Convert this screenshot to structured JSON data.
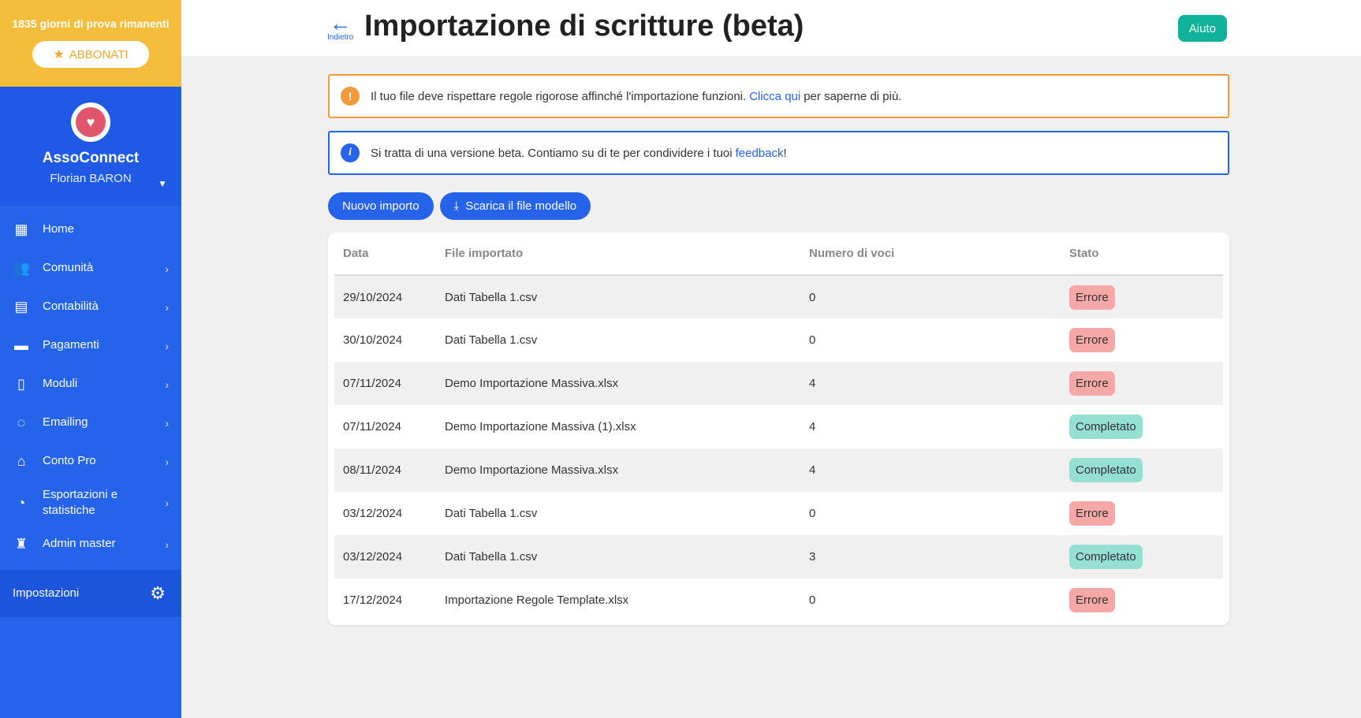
{
  "trial": {
    "text": "1835 giorni di prova rimanenti",
    "subscribe_label": "ABBONATI"
  },
  "org": {
    "name": "AssoConnect",
    "user": "Florian BARON"
  },
  "nav": [
    {
      "label": "Home",
      "icon": "dashboard-icon",
      "glyph": "▦"
    },
    {
      "label": "Comunità",
      "icon": "people-icon",
      "glyph": "👥"
    },
    {
      "label": "Contabilità",
      "icon": "calculator-icon",
      "glyph": "▤"
    },
    {
      "label": "Pagamenti",
      "icon": "credit-card-icon",
      "glyph": "▬"
    },
    {
      "label": "Moduli",
      "icon": "document-icon",
      "glyph": "▯"
    },
    {
      "label": "Emailing",
      "icon": "chat-icon",
      "glyph": "◌"
    },
    {
      "label": "Conto Pro",
      "icon": "bank-icon",
      "glyph": "⌂"
    },
    {
      "label": "Esportazioni e statistiche",
      "icon": "pie-chart-icon",
      "glyph": "◔"
    },
    {
      "label": "Admin master",
      "icon": "admin-icon",
      "glyph": "♜"
    }
  ],
  "settings_label": "Impostazioni",
  "header": {
    "back_label": "Indietro",
    "title": "Importazione di scritture (beta)",
    "help_label": "Aiuto"
  },
  "alerts": {
    "warning": {
      "before": "Il tuo file deve rispettare regole rigorose affinché l'importazione funzioni.",
      "link": "Clicca qui",
      "after": "per saperne di più."
    },
    "info": {
      "before": "Si tratta di una versione beta. Contiamo su di te per condividere i tuoi",
      "link": "feedback",
      "after": "!"
    }
  },
  "actions": {
    "new_import": "Nuovo importo",
    "download_template": "Scarica il file modello"
  },
  "table": {
    "headers": [
      "Data",
      "File importato",
      "Numero di voci",
      "Stato"
    ],
    "rows": [
      {
        "date": "29/10/2024",
        "file": "Dati Tabella 1.csv",
        "count": "0",
        "status": "Errore"
      },
      {
        "date": "30/10/2024",
        "file": "Dati Tabella 1.csv",
        "count": "0",
        "status": "Errore"
      },
      {
        "date": "07/11/2024",
        "file": "Demo Importazione Massiva.xlsx",
        "count": "4",
        "status": "Errore"
      },
      {
        "date": "07/11/2024",
        "file": "Demo Importazione Massiva (1).xlsx",
        "count": "4",
        "status": "Completato"
      },
      {
        "date": "08/11/2024",
        "file": "Demo Importazione Massiva.xlsx",
        "count": "4",
        "status": "Completato"
      },
      {
        "date": "03/12/2024",
        "file": "Dati Tabella 1.csv",
        "count": "0",
        "status": "Errore"
      },
      {
        "date": "03/12/2024",
        "file": "Dati Tabella 1.csv",
        "count": "3",
        "status": "Completato"
      },
      {
        "date": "17/12/2024",
        "file": "Importazione Regole Template.xlsx",
        "count": "0",
        "status": "Errore"
      }
    ]
  },
  "colors": {
    "sidebar": "#2563eb",
    "trial": "#f4bd3c",
    "help": "#10b39a",
    "warning": "#f39a3d",
    "error_badge": "#f5a8a6",
    "ok_badge": "#95dfd3"
  }
}
